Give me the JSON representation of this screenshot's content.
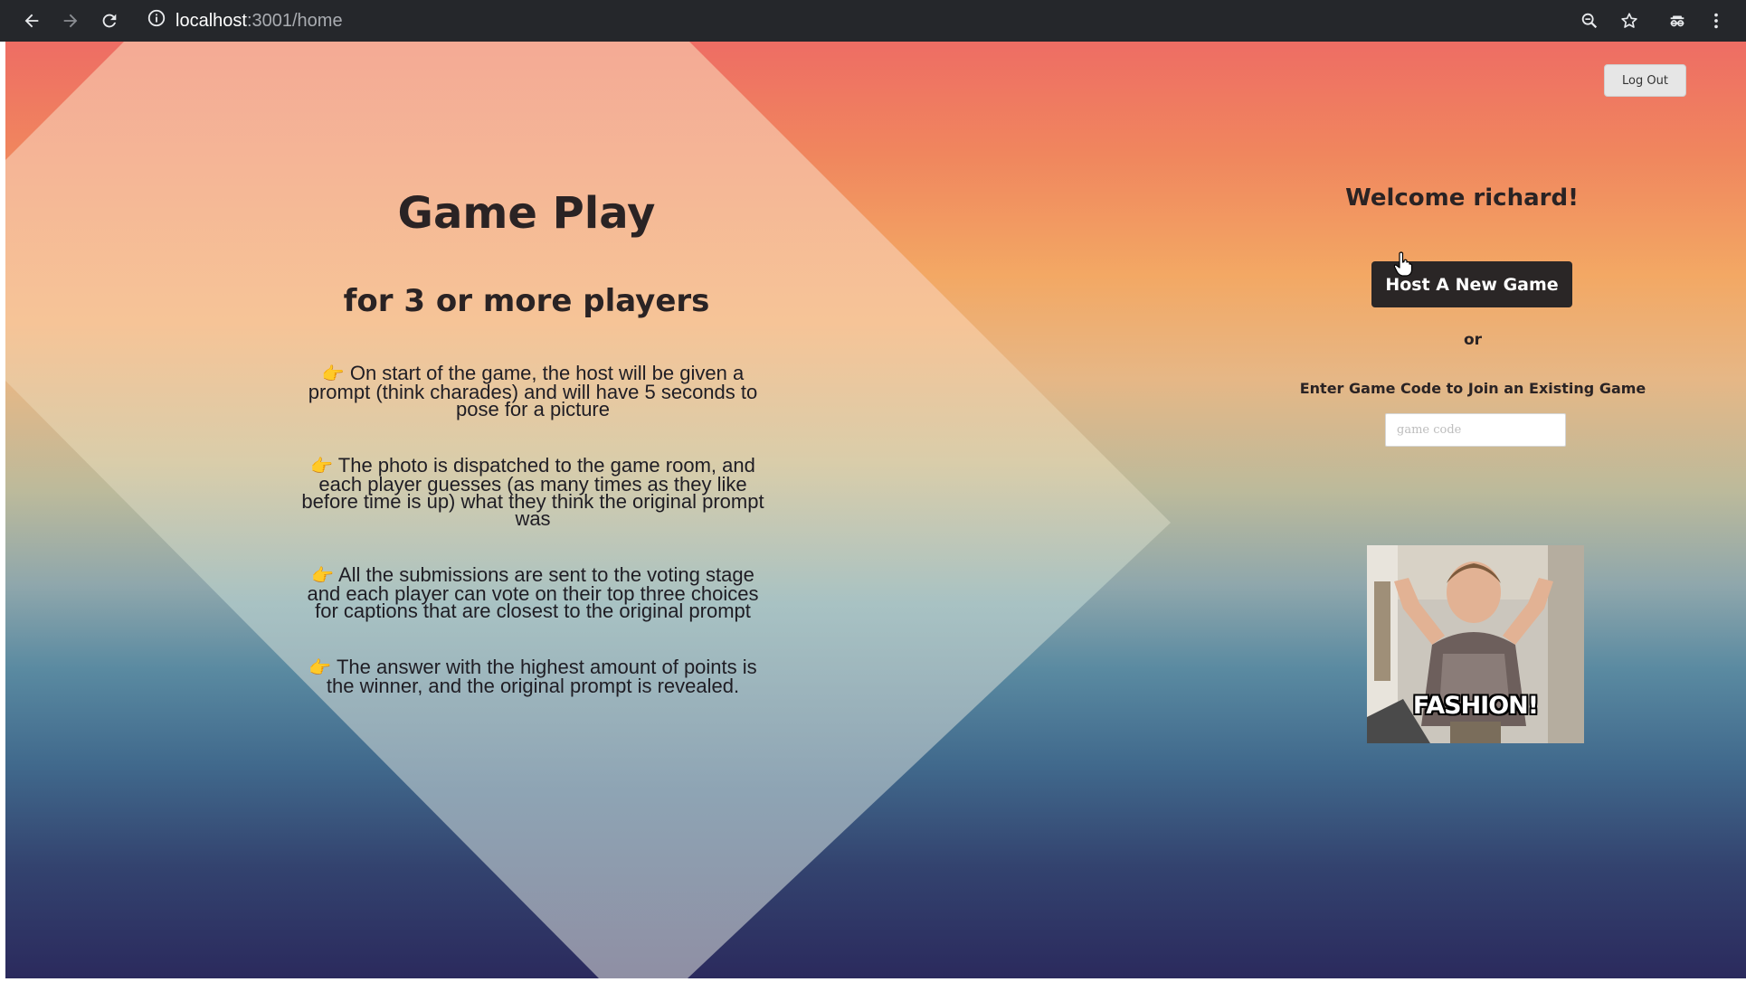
{
  "browser": {
    "url_host": "localhost",
    "url_path": ":3001/home",
    "icons": [
      "back-arrow-icon",
      "forward-arrow-icon",
      "reload-icon",
      "info-icon",
      "zoom-icon",
      "bookmark-star-icon",
      "extension-icon",
      "more-menu-icon"
    ]
  },
  "header": {
    "logout_label": "Log Out"
  },
  "intro": {
    "title": "Game Play",
    "subtitle": "for 3 or more players",
    "rules": [
      "On start of the game, the host will be given a prompt (think charades) and will have 5 seconds to pose for a picture",
      "The photo is dispatched to the game room, and each player guesses (as many times as they like before time is up) what they think the original prompt was",
      "All the submissions are sent to the voting stage and each player can vote on their top three choices for captions that are closest to the original prompt",
      "The answer with the highest amount of points is the winner, and the original prompt is revealed."
    ],
    "bullet_icon": "pointing-hand-icon",
    "bullet_glyph": "👉"
  },
  "lobby": {
    "welcome": "Welcome richard!",
    "host_button_label": "Host A New Game",
    "or_label": "or",
    "join_label": "Enter Game Code to Join an Existing Game",
    "game_code_placeholder": "game code",
    "game_code_value": "",
    "gif_caption": "FASHION!"
  },
  "colors": {
    "gradient_top": "#ee6d64",
    "gradient_mid": "#f3a864",
    "gradient_bottom": "#2b2a5d",
    "button_dark": "#2a2626",
    "browser_toolbar": "#25272b"
  }
}
